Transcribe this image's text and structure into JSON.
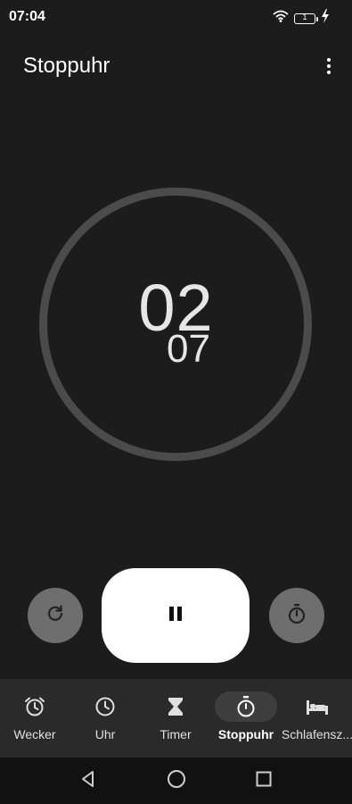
{
  "status_bar": {
    "time": "07:04",
    "battery_level": "1",
    "icons": [
      "wifi-icon",
      "battery-icon",
      "charging-icon"
    ]
  },
  "app": {
    "title": "Stoppuhr"
  },
  "stopwatch": {
    "main": "02",
    "sub": "07"
  },
  "controls": {
    "reset": "reset-icon",
    "pause": "pause-icon",
    "lap": "lap-icon"
  },
  "nav": {
    "items": [
      {
        "label": "Wecker",
        "icon": "alarm-icon",
        "active": false
      },
      {
        "label": "Uhr",
        "icon": "clock-icon",
        "active": false
      },
      {
        "label": "Timer",
        "icon": "hourglass-icon",
        "active": false
      },
      {
        "label": "Stoppuhr",
        "icon": "stopwatch-icon",
        "active": true
      },
      {
        "label": "Schlafensz...",
        "icon": "bed-icon",
        "active": false
      }
    ]
  },
  "colors": {
    "background": "#1c1c1c",
    "ring": "#4b4b4b",
    "nav_background": "#2a2a2a",
    "active_pill": "#3e3e3e",
    "pause_button": "#ffffff",
    "secondary_button": "#6e6e6e"
  }
}
